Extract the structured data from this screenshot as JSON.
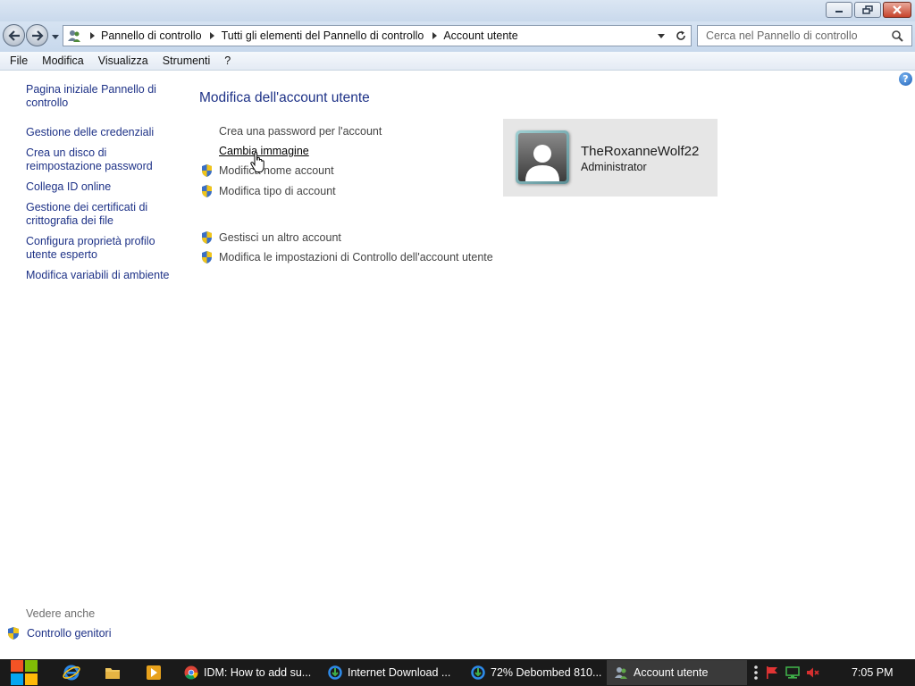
{
  "window": {
    "minimize": "minimize-icon",
    "maximize": "restore-icon",
    "close": "close-icon"
  },
  "address": {
    "breadcrumbs": [
      "Pannello di controllo",
      "Tutti gli elementi del Pannello di controllo",
      "Account utente"
    ]
  },
  "search": {
    "placeholder": "Cerca nel Pannello di controllo"
  },
  "menu": {
    "items": [
      "File",
      "Modifica",
      "Visualizza",
      "Strumenti",
      "?"
    ]
  },
  "leftpane": {
    "home": "Pagina iniziale Pannello di controllo",
    "links": [
      "Gestione delle credenziali",
      "Crea un disco di reimpostazione password",
      "Collega ID online",
      "Gestione dei certificati di crittografia dei file",
      "Configura proprietà profilo utente esperto",
      "Modifica variabili di ambiente"
    ],
    "see_also": "Vedere anche",
    "parental": "Controllo genitori"
  },
  "main": {
    "title": "Modifica dell'account utente",
    "tasks": [
      "Crea una password per l'account",
      "Cambia immagine",
      "Modifica nome account",
      "Modifica tipo di account"
    ],
    "tasks2": [
      "Gestisci un altro account",
      "Modifica le impostazioni di Controllo dell'account utente"
    ]
  },
  "account": {
    "name": "TheRoxanneWolf22",
    "role": "Administrator"
  },
  "taskbar": {
    "tasks": [
      "IDM: How to add su...",
      "Internet Download ...",
      "72% Debombed 810...",
      "Account utente"
    ],
    "clock": "7:05 PM"
  }
}
